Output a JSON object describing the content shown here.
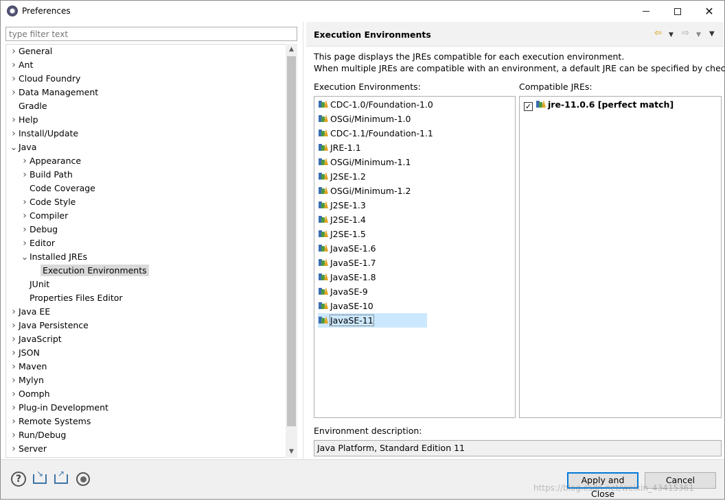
{
  "window": {
    "title": "Preferences",
    "icon": "eclipse-gear-icon"
  },
  "filter": {
    "placeholder": "type filter text"
  },
  "tree": [
    {
      "label": "General",
      "expander": "collapsed",
      "level": 0
    },
    {
      "label": "Ant",
      "expander": "collapsed",
      "level": 0
    },
    {
      "label": "Cloud Foundry",
      "expander": "collapsed",
      "level": 0
    },
    {
      "label": "Data Management",
      "expander": "collapsed",
      "level": 0
    },
    {
      "label": "Gradle",
      "expander": "none",
      "level": 0
    },
    {
      "label": "Help",
      "expander": "collapsed",
      "level": 0
    },
    {
      "label": "Install/Update",
      "expander": "collapsed",
      "level": 0
    },
    {
      "label": "Java",
      "expander": "expanded",
      "level": 0
    },
    {
      "label": "Appearance",
      "expander": "collapsed",
      "level": 1
    },
    {
      "label": "Build Path",
      "expander": "collapsed",
      "level": 1
    },
    {
      "label": "Code Coverage",
      "expander": "none",
      "level": 1
    },
    {
      "label": "Code Style",
      "expander": "collapsed",
      "level": 1
    },
    {
      "label": "Compiler",
      "expander": "collapsed",
      "level": 1
    },
    {
      "label": "Debug",
      "expander": "collapsed",
      "level": 1
    },
    {
      "label": "Editor",
      "expander": "collapsed",
      "level": 1
    },
    {
      "label": "Installed JREs",
      "expander": "expanded",
      "level": 1
    },
    {
      "label": "Execution Environments",
      "expander": "none",
      "level": 2,
      "selected": true
    },
    {
      "label": "JUnit",
      "expander": "none",
      "level": 1
    },
    {
      "label": "Properties Files Editor",
      "expander": "none",
      "level": 1
    },
    {
      "label": "Java EE",
      "expander": "collapsed",
      "level": 0
    },
    {
      "label": "Java Persistence",
      "expander": "collapsed",
      "level": 0
    },
    {
      "label": "JavaScript",
      "expander": "collapsed",
      "level": 0
    },
    {
      "label": "JSON",
      "expander": "collapsed",
      "level": 0
    },
    {
      "label": "Maven",
      "expander": "collapsed",
      "level": 0
    },
    {
      "label": "Mylyn",
      "expander": "collapsed",
      "level": 0
    },
    {
      "label": "Oomph",
      "expander": "collapsed",
      "level": 0
    },
    {
      "label": "Plug-in Development",
      "expander": "collapsed",
      "level": 0
    },
    {
      "label": "Remote Systems",
      "expander": "collapsed",
      "level": 0
    },
    {
      "label": "Run/Debug",
      "expander": "collapsed",
      "level": 0
    },
    {
      "label": "Server",
      "expander": "collapsed",
      "level": 0
    }
  ],
  "page": {
    "title": "Execution Environments",
    "description_line1": "This page displays the JREs compatible for each execution environment.",
    "description_line2": "When multiple JREs are compatible with an environment, a default JRE can be specified by checking it.",
    "environments_label": "Execution Environments:",
    "compatible_label": "Compatible JREs:",
    "environments": [
      "CDC-1.0/Foundation-1.0",
      "OSGi/Minimum-1.0",
      "CDC-1.1/Foundation-1.1",
      "JRE-1.1",
      "OSGi/Minimum-1.1",
      "J2SE-1.2",
      "OSGi/Minimum-1.2",
      "J2SE-1.3",
      "J2SE-1.4",
      "J2SE-1.5",
      "JavaSE-1.6",
      "JavaSE-1.7",
      "JavaSE-1.8",
      "JavaSE-9",
      "JavaSE-10",
      "JavaSE-11"
    ],
    "selected_environment": "JavaSE-11",
    "compatible_jres": [
      {
        "label": "jre-11.0.6 [perfect match]",
        "checked": true
      }
    ],
    "env_description_label": "Environment description:",
    "env_description": "Java Platform, Standard Edition 11"
  },
  "buttons": {
    "apply_close": "Apply and Close",
    "cancel": "Cancel"
  },
  "watermark": "https://blog.csdn.net/weixin_43415361"
}
